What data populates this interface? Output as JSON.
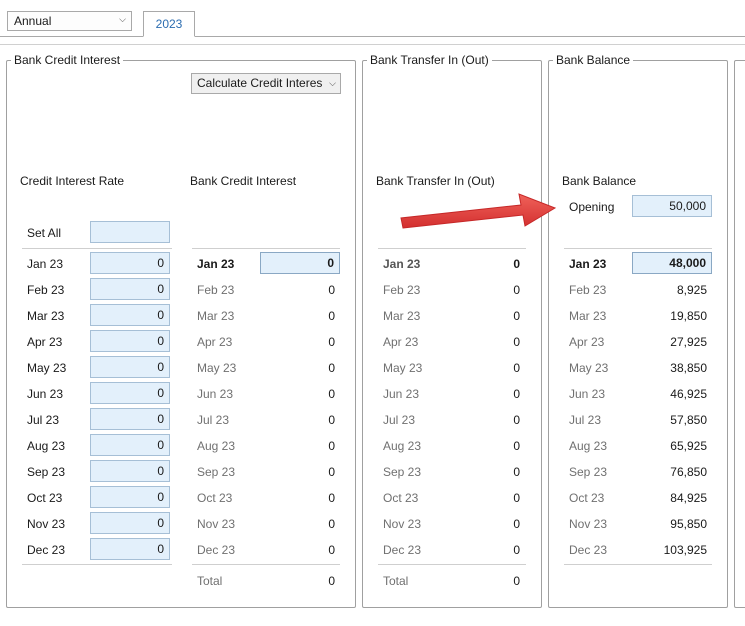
{
  "toolbar": {
    "period": "Annual",
    "tab": "2023"
  },
  "months": [
    "Jan 23",
    "Feb 23",
    "Mar 23",
    "Apr 23",
    "May 23",
    "Jun 23",
    "Jul 23",
    "Aug 23",
    "Sep 23",
    "Oct 23",
    "Nov 23",
    "Dec 23"
  ],
  "credit_interest_group": {
    "title": "Bank Credit Interest",
    "calculate_button": "Calculate Credit Interes",
    "rate_header": "Credit Interest Rate",
    "interest_header": "Bank Credit Interest",
    "set_all_label": "Set All",
    "set_all_value": "",
    "rates": [
      "0",
      "0",
      "0",
      "0",
      "0",
      "0",
      "0",
      "0",
      "0",
      "0",
      "0",
      "0"
    ],
    "interest": [
      "0",
      "0",
      "0",
      "0",
      "0",
      "0",
      "0",
      "0",
      "0",
      "0",
      "0",
      "0"
    ],
    "total_label": "Total",
    "total_value": "0"
  },
  "transfer_group": {
    "title": "Bank Transfer In (Out)",
    "header": "Bank Transfer In (Out)",
    "values": [
      "0",
      "0",
      "0",
      "0",
      "0",
      "0",
      "0",
      "0",
      "0",
      "0",
      "0",
      "0"
    ],
    "total_label": "Total",
    "total_value": "0"
  },
  "balance_group": {
    "title": "Bank Balance",
    "header": "Bank Balance",
    "opening_label": "Opening",
    "opening_value": "50,000",
    "values": [
      "48,000",
      "8,925",
      "19,850",
      "27,925",
      "38,850",
      "46,925",
      "57,850",
      "65,925",
      "76,850",
      "84,925",
      "95,850",
      "103,925"
    ]
  },
  "colors": {
    "input_bg": "#e3f0fb",
    "arrow": "#e53935",
    "tab_text": "#2b6cb0"
  }
}
